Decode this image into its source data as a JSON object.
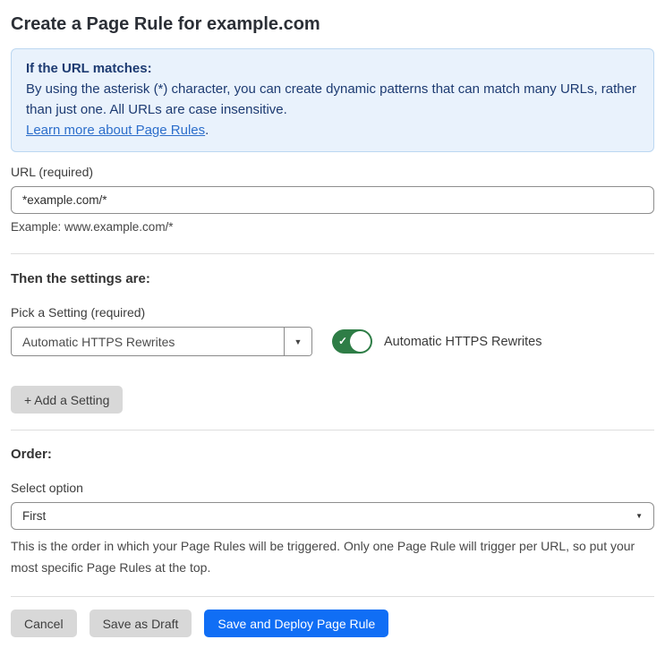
{
  "page": {
    "title": "Create a Page Rule for example.com"
  },
  "info_box": {
    "heading": "If the URL matches:",
    "body": "By using the asterisk (*) character, you can create dynamic patterns that can match many URLs, rather than just one. All URLs are case insensitive.",
    "link_label": "Learn more about Page Rules",
    "link_suffix": "."
  },
  "url_field": {
    "label": "URL (required)",
    "value": "*example.com/*",
    "helper": "Example: www.example.com/*"
  },
  "settings_section": {
    "heading": "Then the settings are:",
    "pick_label": "Pick a Setting (required)",
    "selected_setting": "Automatic HTTPS Rewrites",
    "dropdown_caret": "▼",
    "toggle_state": "on",
    "toggle_check": "✓",
    "toggle_label": "Automatic HTTPS Rewrites",
    "add_setting_label": "+ Add a Setting"
  },
  "order_section": {
    "heading": "Order:",
    "select_label": "Select option",
    "selected_option": "First",
    "select_caret": "▼",
    "helper": "This is the order in which your Page Rules will be triggered. Only one Page Rule will trigger per URL, so put your most specific Page Rules at the top."
  },
  "footer": {
    "cancel_label": "Cancel",
    "save_draft_label": "Save as Draft",
    "save_deploy_label": "Save and Deploy Page Rule"
  },
  "colors": {
    "accent_blue": "#106ef5",
    "info_bg": "#e9f2fc",
    "info_border": "#bcd7f1",
    "info_text": "#1d3b72",
    "link_blue": "#2c6ecb",
    "toggle_green": "#2e7d46",
    "button_gray": "#d8d8d8"
  }
}
